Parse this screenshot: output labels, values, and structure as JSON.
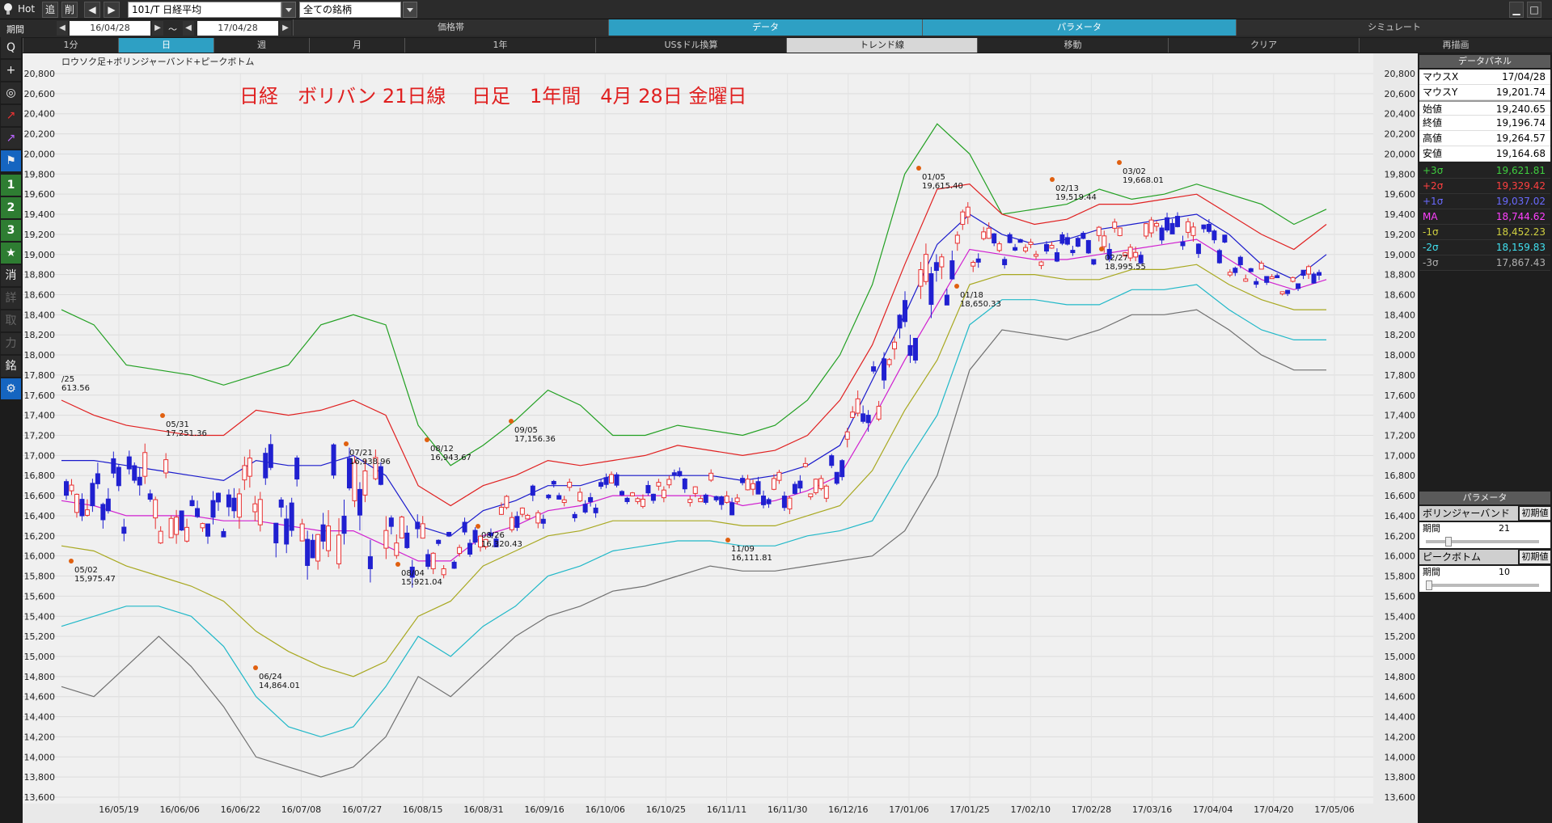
{
  "toolbar": {
    "hot": "Hot",
    "add": "追",
    "del": "削",
    "symbol": "101/T 日経平均",
    "group": "全ての銘柄"
  },
  "row2": {
    "period_label": "期間",
    "from_date": "16/04/28",
    "tilde": "～",
    "to_date": "17/04/28",
    "tabs": [
      "価格帯",
      "データ",
      "パラメータ",
      "シミュレート"
    ]
  },
  "row3": {
    "tabs": [
      "1分",
      "日",
      "週",
      "月",
      "1年",
      "US$ドル換算",
      "トレンド線",
      "移動",
      "クリア",
      "再描画"
    ]
  },
  "lefttool": {
    "buttons": [
      "Q",
      "+",
      "◎",
      "↗",
      "↗",
      "⚑",
      "1",
      "2",
      "3",
      "★",
      "消",
      "詳",
      "取",
      "力",
      "銘",
      "⚙"
    ]
  },
  "chart_title_left": "ロウソク足+ボリンジャーバンド+ピークボトム",
  "chart_headline": "日経　ボリバン 21日線　 日足　1年間　4月 28日 金曜日",
  "colors": {
    "plus3": "#22a022",
    "plus2": "#e02020",
    "plus1": "#1a1acc",
    "ma": "#d020d0",
    "minus1": "#a8a820",
    "minus2": "#20b8c8",
    "minus3": "#707070",
    "up_candle": "#e83030",
    "down_candle": "#2020d0",
    "accent": "#2ea0c4"
  },
  "panel": {
    "data_header": "データパネル",
    "rows": [
      {
        "label": "マウスX",
        "value": "17/04/28"
      },
      {
        "label": "マウスY",
        "value": "19,201.74"
      },
      {
        "label": "始値",
        "value": "19,240.65"
      },
      {
        "label": "終値",
        "value": "19,196.74"
      },
      {
        "label": "高値",
        "value": "19,264.57"
      },
      {
        "label": "安値",
        "value": "19,164.68"
      }
    ],
    "bands": [
      {
        "label": "+3σ",
        "value": "19,621.81",
        "color": "#3fcf3f"
      },
      {
        "label": "+2σ",
        "value": "19,329.42",
        "color": "#ff4040"
      },
      {
        "label": "+1σ",
        "value": "19,037.02",
        "color": "#6a6aff"
      },
      {
        "label": "MA",
        "value": "18,744.62",
        "color": "#ff40ff"
      },
      {
        "label": "-1σ",
        "value": "18,452.23",
        "color": "#d0d040"
      },
      {
        "label": "-2σ",
        "value": "18,159.83",
        "color": "#40e0f0"
      },
      {
        "label": "-3σ",
        "value": "17,867.43",
        "color": "#b0b0b0"
      }
    ],
    "param_header": "パラメータ",
    "boll_label": "ボリンジャーバンド",
    "reset_label": "初期値",
    "period_label": "期間",
    "boll_period": "21",
    "peak_label": "ピークボトム",
    "peak_period": "10"
  },
  "chart_data": {
    "type": "candlestick",
    "title": "日経　ボリバン 21日線　 日足　1年間　4月 28日 金曜日",
    "ylim": [
      13600,
      20800
    ],
    "y_ticks": [
      20800,
      20600,
      20400,
      20200,
      20000,
      19800,
      19600,
      19400,
      19200,
      19000,
      18800,
      18600,
      18400,
      18200,
      18000,
      17800,
      17600,
      17400,
      17200,
      17000,
      16800,
      16600,
      16400,
      16200,
      16000,
      15800,
      15600,
      15400,
      15200,
      15000,
      14800,
      14600,
      14400,
      14200,
      14000,
      13800,
      13600
    ],
    "x_ticks": [
      "16/05/19",
      "16/06/06",
      "16/06/22",
      "16/07/08",
      "16/07/27",
      "16/08/15",
      "16/08/31",
      "16/09/16",
      "16/10/06",
      "16/10/25",
      "16/11/11",
      "16/11/30",
      "16/12/16",
      "17/01/06",
      "17/01/25",
      "17/02/10",
      "17/02/28",
      "17/03/16",
      "17/04/04",
      "17/04/20",
      "17/05/06"
    ],
    "series": [
      {
        "name": "+3σ",
        "values": [
          18450,
          18300,
          17900,
          17850,
          17800,
          17700,
          17800,
          17900,
          18300,
          18400,
          18300,
          17300,
          16900,
          17100,
          17350,
          17650,
          17500,
          17200,
          17200,
          17300,
          17250,
          17200,
          17300,
          17550,
          18000,
          18700,
          19800,
          20300,
          20000,
          19400,
          19450,
          19500,
          19650,
          19550,
          19600,
          19700,
          19600,
          19500,
          19300,
          19450
        ]
      },
      {
        "name": "+2σ",
        "values": [
          17550,
          17400,
          17300,
          17250,
          17200,
          17200,
          17450,
          17400,
          17450,
          17550,
          17400,
          16700,
          16500,
          16700,
          16800,
          16950,
          16900,
          16950,
          17000,
          17100,
          17050,
          17000,
          17050,
          17200,
          17550,
          18100,
          18900,
          19650,
          19700,
          19400,
          19300,
          19350,
          19500,
          19500,
          19550,
          19600,
          19400,
          19200,
          19050,
          19300
        ]
      },
      {
        "name": "+1σ",
        "values": [
          16950,
          16950,
          16900,
          16850,
          16800,
          16750,
          16950,
          16900,
          16900,
          17000,
          16800,
          16300,
          16200,
          16450,
          16550,
          16700,
          16700,
          16800,
          16800,
          16800,
          16800,
          16750,
          16800,
          16900,
          17100,
          17750,
          18400,
          19100,
          19400,
          19200,
          19100,
          19150,
          19250,
          19300,
          19350,
          19400,
          19200,
          18900,
          18750,
          19000
        ]
      },
      {
        "name": "MA",
        "values": [
          16550,
          16500,
          16400,
          16400,
          16400,
          16350,
          16350,
          16300,
          16250,
          16250,
          16100,
          15950,
          15950,
          16200,
          16300,
          16450,
          16500,
          16600,
          16600,
          16600,
          16600,
          16500,
          16550,
          16650,
          16800,
          17350,
          17950,
          18500,
          19050,
          19000,
          18950,
          18950,
          19000,
          19050,
          19100,
          19150,
          18950,
          18750,
          18650,
          18750
        ]
      },
      {
        "name": "-1σ",
        "values": [
          16100,
          16050,
          15900,
          15800,
          15700,
          15550,
          15250,
          15050,
          14900,
          14800,
          14950,
          15400,
          15550,
          15900,
          16050,
          16200,
          16250,
          16350,
          16350,
          16350,
          16350,
          16300,
          16300,
          16400,
          16500,
          16850,
          17450,
          17950,
          18700,
          18800,
          18800,
          18750,
          18750,
          18850,
          18850,
          18900,
          18700,
          18550,
          18450,
          18450
        ]
      },
      {
        "name": "-2σ",
        "values": [
          15300,
          15400,
          15500,
          15500,
          15400,
          15100,
          14600,
          14300,
          14200,
          14300,
          14700,
          15200,
          15000,
          15300,
          15500,
          15800,
          15900,
          16050,
          16100,
          16150,
          16150,
          16100,
          16100,
          16200,
          16250,
          16350,
          16900,
          17400,
          18300,
          18550,
          18550,
          18500,
          18500,
          18650,
          18650,
          18700,
          18450,
          18250,
          18150,
          18150
        ]
      },
      {
        "name": "-3σ",
        "values": [
          14700,
          14600,
          14900,
          15200,
          14900,
          14500,
          14000,
          13900,
          13800,
          13900,
          14200,
          14800,
          14600,
          14900,
          15200,
          15400,
          15500,
          15650,
          15700,
          15800,
          15900,
          15850,
          15850,
          15900,
          15950,
          16000,
          16250,
          16800,
          17850,
          18250,
          18200,
          18150,
          18250,
          18400,
          18400,
          18450,
          18250,
          18000,
          17850,
          17850
        ]
      }
    ],
    "peaks": [
      {
        "date": "05/02",
        "value": "15,975.47"
      },
      {
        "date": "05/31",
        "value": "17,251.36"
      },
      {
        "date": "06/24",
        "value": "14,864.01"
      },
      {
        "date": "07/21",
        "value": "16,938.96"
      },
      {
        "date": "08/04",
        "value": "15,921.04"
      },
      {
        "date": "08/12",
        "value": "16,943.67"
      },
      {
        "date": "08/26",
        "value": "16,320.43"
      },
      {
        "date": "09/05",
        "value": "17,156.36"
      },
      {
        "date": "11/09",
        "value": "16,111.81"
      },
      {
        "date": "01/05",
        "value": "19,615.40"
      },
      {
        "date": "01/18",
        "value": "18,650.33"
      },
      {
        "date": "02/13",
        "value": "19,519.44"
      },
      {
        "date": "02/27",
        "value": "18,995.55"
      },
      {
        "date": "03/02",
        "value": "19,668.01"
      }
    ],
    "start_label": "/25",
    "start_value": "613.56"
  }
}
